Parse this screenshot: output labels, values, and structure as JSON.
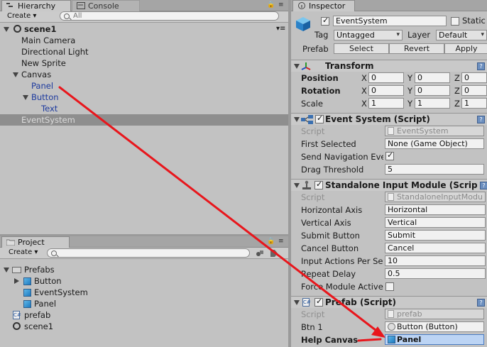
{
  "hierarchy": {
    "tab_label": "Hierarchy",
    "second_tab_label": "Console",
    "create_label": "Create",
    "search_placeholder": "All",
    "scene_name": "scene1",
    "items": {
      "main_camera": "Main Camera",
      "directional_light": "Directional Light",
      "new_sprite": "New Sprite",
      "canvas": "Canvas",
      "panel": "Panel",
      "button": "Button",
      "text": "Text",
      "event_system": "EventSystem"
    }
  },
  "project": {
    "tab_label": "Project",
    "create_label": "Create",
    "search_placeholder": "",
    "items": {
      "prefabs": "Prefabs",
      "button": "Button",
      "event_system": "EventSystem",
      "panel": "Panel",
      "prefab": "prefab",
      "scene1": "scene1"
    }
  },
  "inspector": {
    "tab_label": "Inspector",
    "object_name": "EventSystem",
    "static_label": "Static",
    "tag_label": "Tag",
    "tag_value": "Untagged",
    "layer_label": "Layer",
    "layer_value": "Default",
    "prefab_label": "Prefab",
    "select_label": "Select",
    "revert_label": "Revert",
    "apply_label": "Apply",
    "transform": {
      "title": "Transform",
      "position_label": "Position",
      "rotation_label": "Rotation",
      "scale_label": "Scale",
      "x": "X",
      "y": "Y",
      "z": "Z",
      "position": [
        "0",
        "0",
        "0"
      ],
      "rotation": [
        "0",
        "0",
        "0"
      ],
      "scale": [
        "1",
        "1",
        "1"
      ]
    },
    "event_system": {
      "title": "Event System (Script)",
      "script_label": "Script",
      "script_value": "EventSystem",
      "first_selected_label": "First Selected",
      "first_selected_value": "None (Game Object)",
      "send_nav_label": "Send Navigation Eve",
      "drag_threshold_label": "Drag Threshold",
      "drag_threshold_value": "5"
    },
    "standalone": {
      "title": "Standalone Input Module (Script",
      "script_label": "Script",
      "script_value": "StandaloneInputModu",
      "horizontal_label": "Horizontal Axis",
      "horizontal_value": "Horizontal",
      "vertical_label": "Vertical Axis",
      "vertical_value": "Vertical",
      "submit_label": "Submit Button",
      "submit_value": "Submit",
      "cancel_label": "Cancel Button",
      "cancel_value": "Cancel",
      "input_actions_label": "Input Actions Per Se",
      "input_actions_value": "10",
      "repeat_delay_label": "Repeat Delay",
      "repeat_delay_value": "0.5",
      "force_module_label": "Force Module Active"
    },
    "prefab_script": {
      "title": "Prefab (Script)",
      "script_label": "Script",
      "script_value": "prefab",
      "btn1_label": "Btn 1",
      "btn1_value": "Button (Button)",
      "help_canvas_label": "Help Canvas",
      "help_canvas_value": "Panel"
    }
  },
  "colors": {
    "arrow": "#e8161c",
    "selection": "#8e8e8e",
    "prefab_link": "#1d3a9e"
  }
}
